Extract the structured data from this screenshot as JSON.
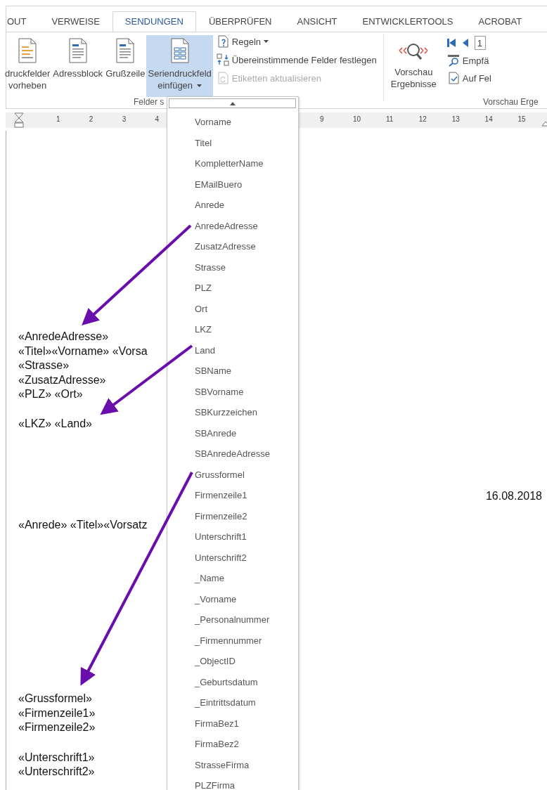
{
  "tabs": [
    {
      "label": "OUT",
      "selected": false
    },
    {
      "label": "VERWEISE",
      "selected": false
    },
    {
      "label": "SENDUNGEN",
      "selected": true
    },
    {
      "label": "ÜBERPRÜFEN",
      "selected": false
    },
    {
      "label": "ANSICHT",
      "selected": false
    },
    {
      "label": "ENTWICKLERTOOLS",
      "selected": false
    },
    {
      "label": "ACROBAT",
      "selected": false
    }
  ],
  "ribbon": {
    "big_buttons": [
      {
        "lines": [
          "druckfelder",
          "vorheben"
        ],
        "selected": false,
        "dropdown": false
      },
      {
        "lines": [
          "Adressblock"
        ],
        "selected": false,
        "dropdown": false
      },
      {
        "lines": [
          "Grußzeile"
        ],
        "selected": false,
        "dropdown": false
      },
      {
        "lines": [
          "Seriendruckfeld",
          "einfügen"
        ],
        "selected": true,
        "dropdown": true
      }
    ],
    "small_buttons": [
      {
        "label": "Regeln",
        "disabled": false,
        "dropdown": true
      },
      {
        "label": "Übereinstimmende Felder festlegen",
        "disabled": false,
        "dropdown": false
      },
      {
        "label": "Etiketten aktualisieren",
        "disabled": true,
        "dropdown": false
      }
    ],
    "group_label": "Felder s",
    "preview_button": {
      "lines": [
        "Vorschau",
        "Ergebnisse"
      ]
    },
    "record_field": {
      "value": "1"
    },
    "nav_buttons": [
      "Empfä",
      "Auf Fel"
    ],
    "preview_group_label": "Vorschau Erge"
  },
  "ruler": {
    "labels": [
      "1",
      "2",
      "3",
      "4",
      "9",
      "10",
      "11",
      "12",
      "13",
      "14",
      "15"
    ]
  },
  "dropdown": {
    "items": [
      "Vorname",
      "Titel",
      "KompletterName",
      "EMailBuero",
      "Anrede",
      "AnredeAdresse",
      "ZusatzAdresse",
      "Strasse",
      "PLZ",
      "Ort",
      "LKZ",
      "Land",
      "SBName",
      "SBVorname",
      "SBKurzzeichen",
      "SBAnrede",
      "SBAnredeAdresse",
      "Grussformel",
      "Firmenzeile1",
      "Firmenzeile2",
      "Unterschrift1",
      "Unterschrift2",
      "_Name",
      "_Vorname",
      "_Personalnummer",
      "_Firmennummer",
      "_ObjectID",
      "_Geburtsdatum",
      "_Eintrittsdatum",
      "FirmaBez1",
      "FirmaBez2",
      "StrasseFirma",
      "PLZFirma"
    ]
  },
  "document": {
    "address_block": [
      "«AnredeAdresse»",
      "«Titel»«Vorname» «Vorsa",
      "«Strasse»",
      "«ZusatzAdresse»",
      "«PLZ» «Ort»"
    ],
    "country_line": "«LKZ» «Land»",
    "date": "16.08.2018",
    "salutation": "«Anrede» «Titel»«Vorsatz",
    "closing_block": [
      "«Grussformel»",
      "«Firmenzeile1»",
      "«Firmenzeile2»"
    ],
    "signature_block": [
      "«Unterschrift1»",
      "«Unterschrift2»"
    ]
  }
}
